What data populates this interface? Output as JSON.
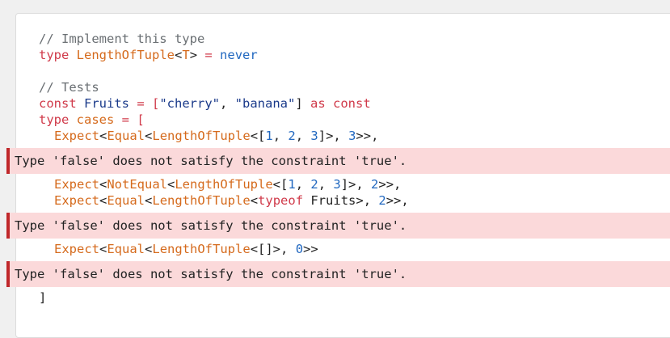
{
  "code": {
    "l1": {
      "comment": "// Implement this type"
    },
    "l2": {
      "kw_type": "type",
      "name": "LengthOfTuple",
      "lt": "<",
      "param": "T",
      "gt": ">",
      "eq": " = ",
      "val": "never"
    },
    "l4": {
      "comment": "// Tests"
    },
    "l5": {
      "kw_const": "const",
      "name": "Fruits",
      "eq": " = [",
      "s1": "\"cherry\"",
      "comma": ", ",
      "s2": "\"banana\"",
      "close": "] ",
      "kw_as": "as",
      "kw_const2": "const"
    },
    "l6": {
      "kw_type": "type",
      "name": "cases",
      "eq": " = ["
    },
    "l7": {
      "expect": "Expect",
      "a": "<",
      "equal": "Equal",
      "b": "<",
      "lot": "LengthOfTuple",
      "c": "<[",
      "n1": "1",
      "d": ", ",
      "n2": "2",
      "e": ", ",
      "n3": "3",
      "f": "]>, ",
      "n4": "3",
      "g": ">>,"
    },
    "l9": {
      "expect": "Expect",
      "a": "<",
      "equal": "NotEqual",
      "b": "<",
      "lot": "LengthOfTuple",
      "c": "<[",
      "n1": "1",
      "d": ", ",
      "n2": "2",
      "e": ", ",
      "n3": "3",
      "f": "]>, ",
      "n4": "2",
      "g": ">>,"
    },
    "l10": {
      "expect": "Expect",
      "a": "<",
      "equal": "Equal",
      "b": "<",
      "lot": "LengthOfTuple",
      "c": "<",
      "kw_typeof": "typeof",
      "ident": " Fruits",
      "f": ">, ",
      "n4": "2",
      "g": ">>,"
    },
    "l12": {
      "expect": "Expect",
      "a": "<",
      "equal": "Equal",
      "b": "<",
      "lot": "LengthOfTuple",
      "c": "<[]>, ",
      "n4": "0",
      "g": ">>"
    },
    "l13": {
      "close": "]"
    }
  },
  "errors": [
    "Type 'false' does not satisfy the constraint 'true'.",
    "Type 'false' does not satisfy the constraint 'true'.",
    "Type 'false' does not satisfy the constraint 'true'."
  ],
  "colors": {
    "keyword": "#d03a4a",
    "type": "#d56a1c",
    "string": "#1a3a8a",
    "number": "#2168c0",
    "comment": "#6a6f73",
    "error_bg": "#fbd9da",
    "error_border": "#c0282b"
  }
}
